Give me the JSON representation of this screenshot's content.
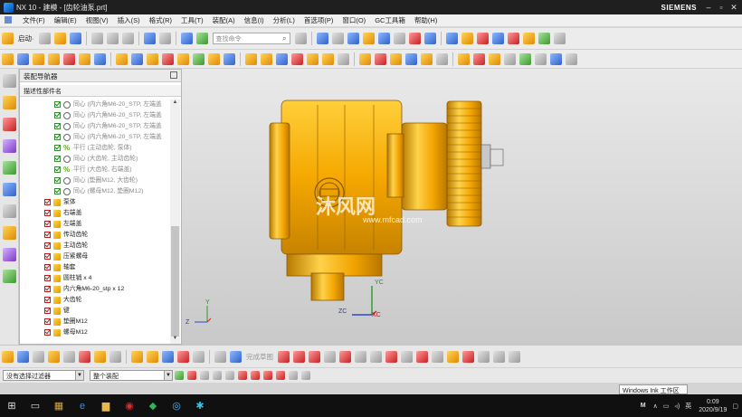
{
  "window": {
    "title": "NX 10 - 建模 - [齿轮油泵.prt]",
    "brand": "SIEMENS"
  },
  "menu": [
    "文件(F)",
    "编辑(E)",
    "视图(V)",
    "插入(S)",
    "格式(R)",
    "工具(T)",
    "装配(A)",
    "信息(I)",
    "分析(L)",
    "首选项(P)",
    "窗口(O)",
    "GC工具箱",
    "帮助(H)"
  ],
  "toolbar": {
    "start_label": "启动·",
    "search_placeholder": "查找命令"
  },
  "navigator": {
    "title": "装配导航器",
    "column_header": "描述性部件名",
    "constraints": [
      {
        "kind": "concentric",
        "label": "同心 (内六角M6-20_STP, 左端盖"
      },
      {
        "kind": "concentric",
        "label": "同心 (内六角M6-20_STP, 左端盖"
      },
      {
        "kind": "concentric",
        "label": "同心 (内六角M6-20_STP, 左端盖"
      },
      {
        "kind": "concentric",
        "label": "同心 (内六角M6-20_STP, 左端盖"
      },
      {
        "kind": "parallel",
        "label": "平行 (主动齿轮, 泵体)"
      },
      {
        "kind": "concentric",
        "label": "同心 (大齿轮, 主动齿轮)"
      },
      {
        "kind": "parallel",
        "label": "平行 (大齿轮, 右端盖)"
      },
      {
        "kind": "concentric",
        "label": "同心 (垫圈M12, 大齿轮)"
      },
      {
        "kind": "concentric",
        "label": "同心 (螺母M12, 垫圈M12)"
      }
    ],
    "parts": [
      "泵体",
      "右端盖",
      "左端盖",
      "传动齿轮",
      "主动齿轮",
      "压紧螺母",
      "轴套",
      "圆柱销 x 4",
      "内六角M6-20_stp x 12",
      "大齿轮",
      "键",
      "垫圈M12",
      "螺母M12"
    ]
  },
  "viewport": {
    "watermark": "沐风网",
    "watermark_url": "www.mfcad.com",
    "axes": {
      "yc": "YC",
      "zc": "ZC",
      "xc": "XC",
      "y": "Y",
      "z": "Z"
    }
  },
  "bottom": {
    "filter_value": "没有选择过滤器",
    "scope_value": "整个装配",
    "dim_label": "完成草图"
  },
  "status": {
    "ink": "Windows Ink 工作区"
  },
  "taskbar": {
    "time": "0:09",
    "date": "2020/9/19",
    "ime": "英",
    "ime_mode": "M"
  }
}
